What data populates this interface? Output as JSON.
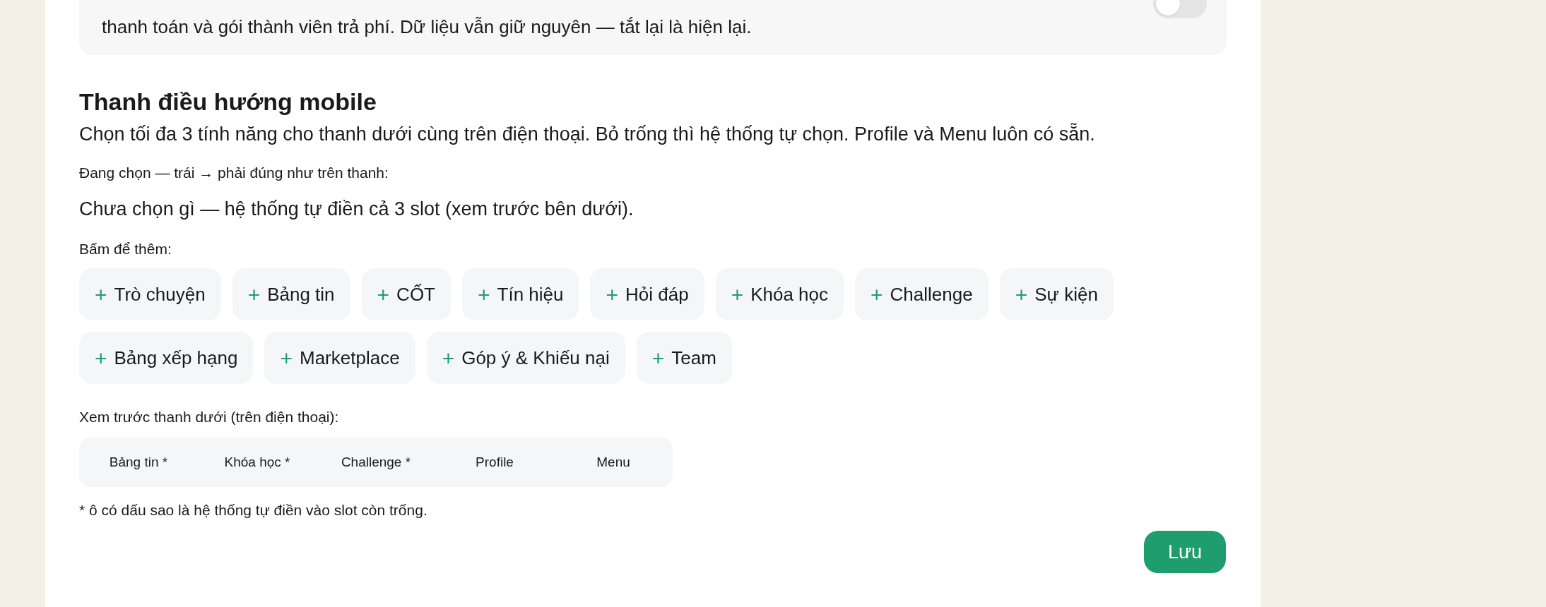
{
  "feature_panel": {
    "description": "thanh toán và gói thành viên trả phí. Dữ liệu vẫn giữ nguyên — tắt lại là hiện lại.",
    "toggle": {
      "on": false
    }
  },
  "mobile_nav": {
    "title": "Thanh điều hướng mobile",
    "description": "Chọn tối đa 3 tính năng cho thanh dưới cùng trên điện thoại. Bỏ trống thì hệ thống tự chọn. Profile và Menu luôn có sẵn.",
    "current_label": "Đang chọn — trái → phải đúng như trên thanh:",
    "current_value": "Chưa chọn gì — hệ thống tự điền cả 3 slot (xem trước bên dưới).",
    "add_label": "Bấm để thêm:",
    "options": [
      {
        "icon": "+",
        "label": "Trò chuyện"
      },
      {
        "icon": "+",
        "label": "Bảng tin"
      },
      {
        "icon": "+",
        "label": "CỐT"
      },
      {
        "icon": "+",
        "label": "Tín hiệu"
      },
      {
        "icon": "+",
        "label": "Hỏi đáp"
      },
      {
        "icon": "+",
        "label": "Khóa học"
      },
      {
        "icon": "+",
        "label": "Challenge"
      },
      {
        "icon": "+",
        "label": "Sự kiện"
      },
      {
        "icon": "+",
        "label": "Bảng xếp hạng"
      },
      {
        "icon": "+",
        "label": "Marketplace"
      },
      {
        "icon": "+",
        "label": "Góp ý & Khiếu nại"
      },
      {
        "icon": "+",
        "label": "Team"
      }
    ],
    "preview_label": "Xem trước thanh dưới (trên điện thoại):",
    "preview_slots": [
      "Bảng tin *",
      "Khóa học *",
      "Challenge *",
      "Profile",
      "Menu"
    ],
    "footnote": "* ô có dấu sao là hệ thống tự điền vào slot còn trống."
  },
  "save_button": "Lưu"
}
